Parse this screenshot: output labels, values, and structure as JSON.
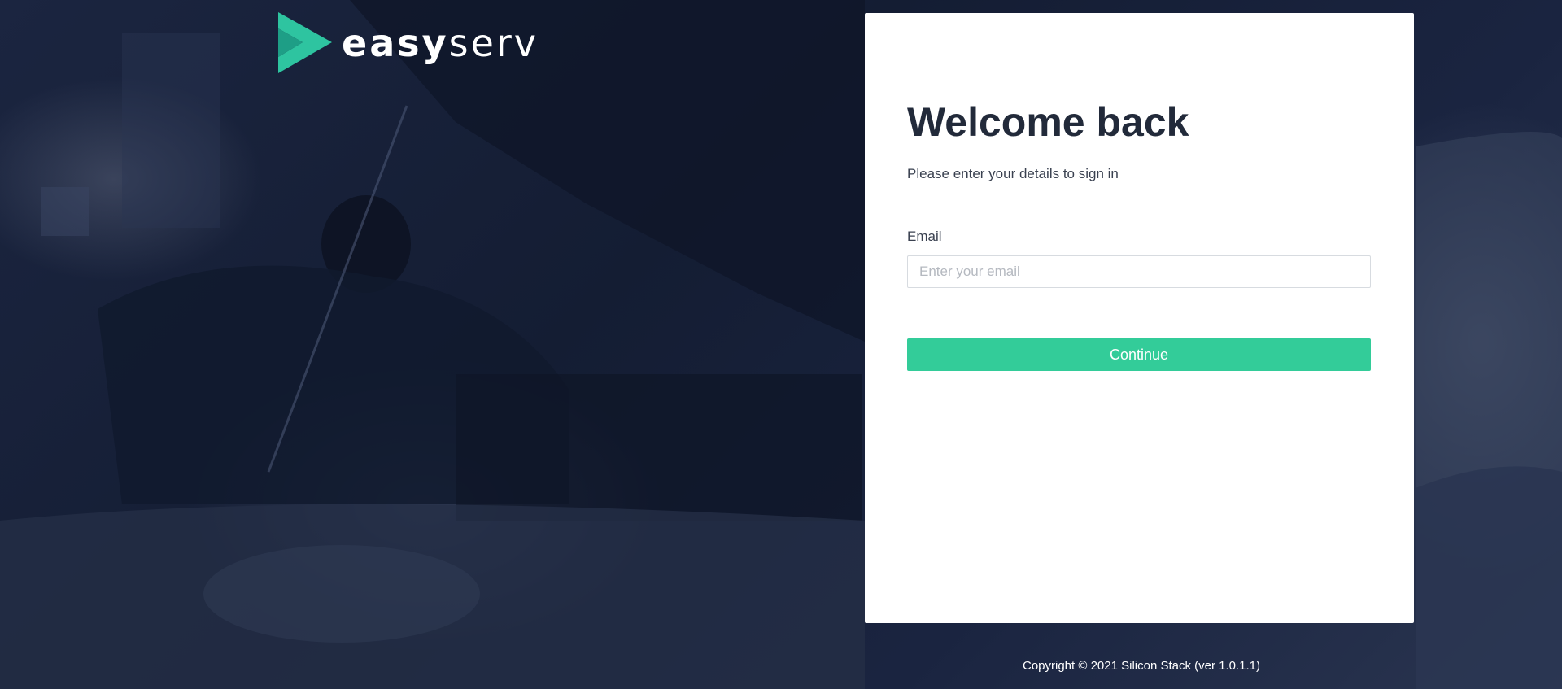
{
  "brand": {
    "name_bold": "easy",
    "name_thin": "serv",
    "colors": {
      "mark_primary": "#2ec4a0",
      "mark_secondary": "#1e9e86"
    }
  },
  "login": {
    "heading": "Welcome back",
    "subtitle": "Please enter your details to sign in",
    "email_label": "Email",
    "email_placeholder": "Enter your email",
    "email_value": "",
    "continue_label": "Continue"
  },
  "footer": {
    "copyright": "Copyright © 2021 Silicon Stack (ver 1.0.1.1)"
  },
  "colors": {
    "accent": "#33cc99",
    "heading": "#222a3a",
    "background": "#1b2540"
  }
}
